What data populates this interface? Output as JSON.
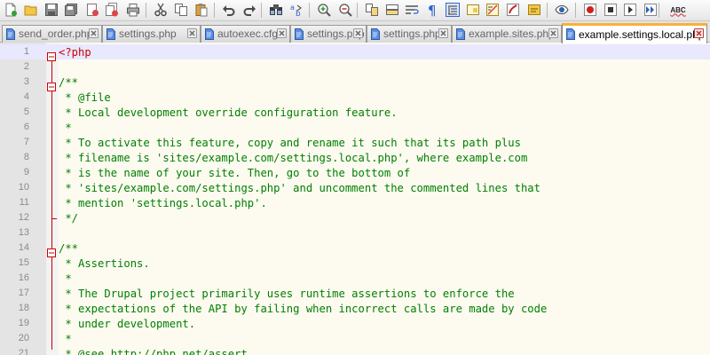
{
  "toolbar": {
    "icons": [
      "new-file-icon",
      "open-file-icon",
      "save-icon",
      "save-all-icon",
      "close-icon",
      "close-all-icon",
      "print-icon",
      "cut-icon",
      "copy-icon",
      "paste-icon",
      "undo-icon",
      "redo-icon",
      "find-icon",
      "replace-icon",
      "zoom-in-icon",
      "zoom-out-icon",
      "sync-vertical-icon",
      "sync-horizontal-icon",
      "word-wrap-icon",
      "show-all-characters-icon",
      "indent-guide-icon",
      "document-map-icon",
      "function-list-icon",
      "folder-as-workspace-icon",
      "monitoring-icon",
      "record-macro-icon",
      "stop-macro-icon",
      "play-macro-icon",
      "run-macro-multiple-icon",
      "save-macro-icon",
      "spell-check-icon"
    ],
    "spell_label": "ABC"
  },
  "tabs": [
    {
      "label": "send_order.php",
      "active": false
    },
    {
      "label": "settings.php",
      "active": false
    },
    {
      "label": "autoexec.cfg",
      "active": false
    },
    {
      "label": "settings.php",
      "active": false
    },
    {
      "label": "settings.php",
      "active": false
    },
    {
      "label": "example.sites.php",
      "active": false
    },
    {
      "label": "example.settings.local.php",
      "active": true
    }
  ],
  "editor": {
    "lines": [
      {
        "n": "1",
        "text": "<?php"
      },
      {
        "n": "2",
        "text": ""
      },
      {
        "n": "3",
        "text": "/**"
      },
      {
        "n": "4",
        "text": " * @file"
      },
      {
        "n": "5",
        "text": " * Local development override configuration feature."
      },
      {
        "n": "6",
        "text": " *"
      },
      {
        "n": "7",
        "text": " * To activate this feature, copy and rename it such that its path plus"
      },
      {
        "n": "8",
        "text": " * filename is 'sites/example.com/settings.local.php', where example.com"
      },
      {
        "n": "9",
        "text": " * is the name of your site. Then, go to the bottom of"
      },
      {
        "n": "10",
        "text": " * 'sites/example.com/settings.php' and uncomment the commented lines that"
      },
      {
        "n": "11",
        "text": " * mention 'settings.local.php'."
      },
      {
        "n": "12",
        "text": " */"
      },
      {
        "n": "13",
        "text": ""
      },
      {
        "n": "14",
        "text": "/**"
      },
      {
        "n": "15",
        "text": " * Assertions."
      },
      {
        "n": "16",
        "text": " *"
      },
      {
        "n": "17",
        "text": " * The Drupal project primarily uses runtime assertions to enforce the"
      },
      {
        "n": "18",
        "text": " * expectations of the API by failing when incorrect calls are made by code"
      },
      {
        "n": "19",
        "text": " * under development."
      },
      {
        "n": "20",
        "text": " *"
      },
      {
        "n": "21",
        "text": " * @see http://php.net/assert"
      }
    ]
  }
}
